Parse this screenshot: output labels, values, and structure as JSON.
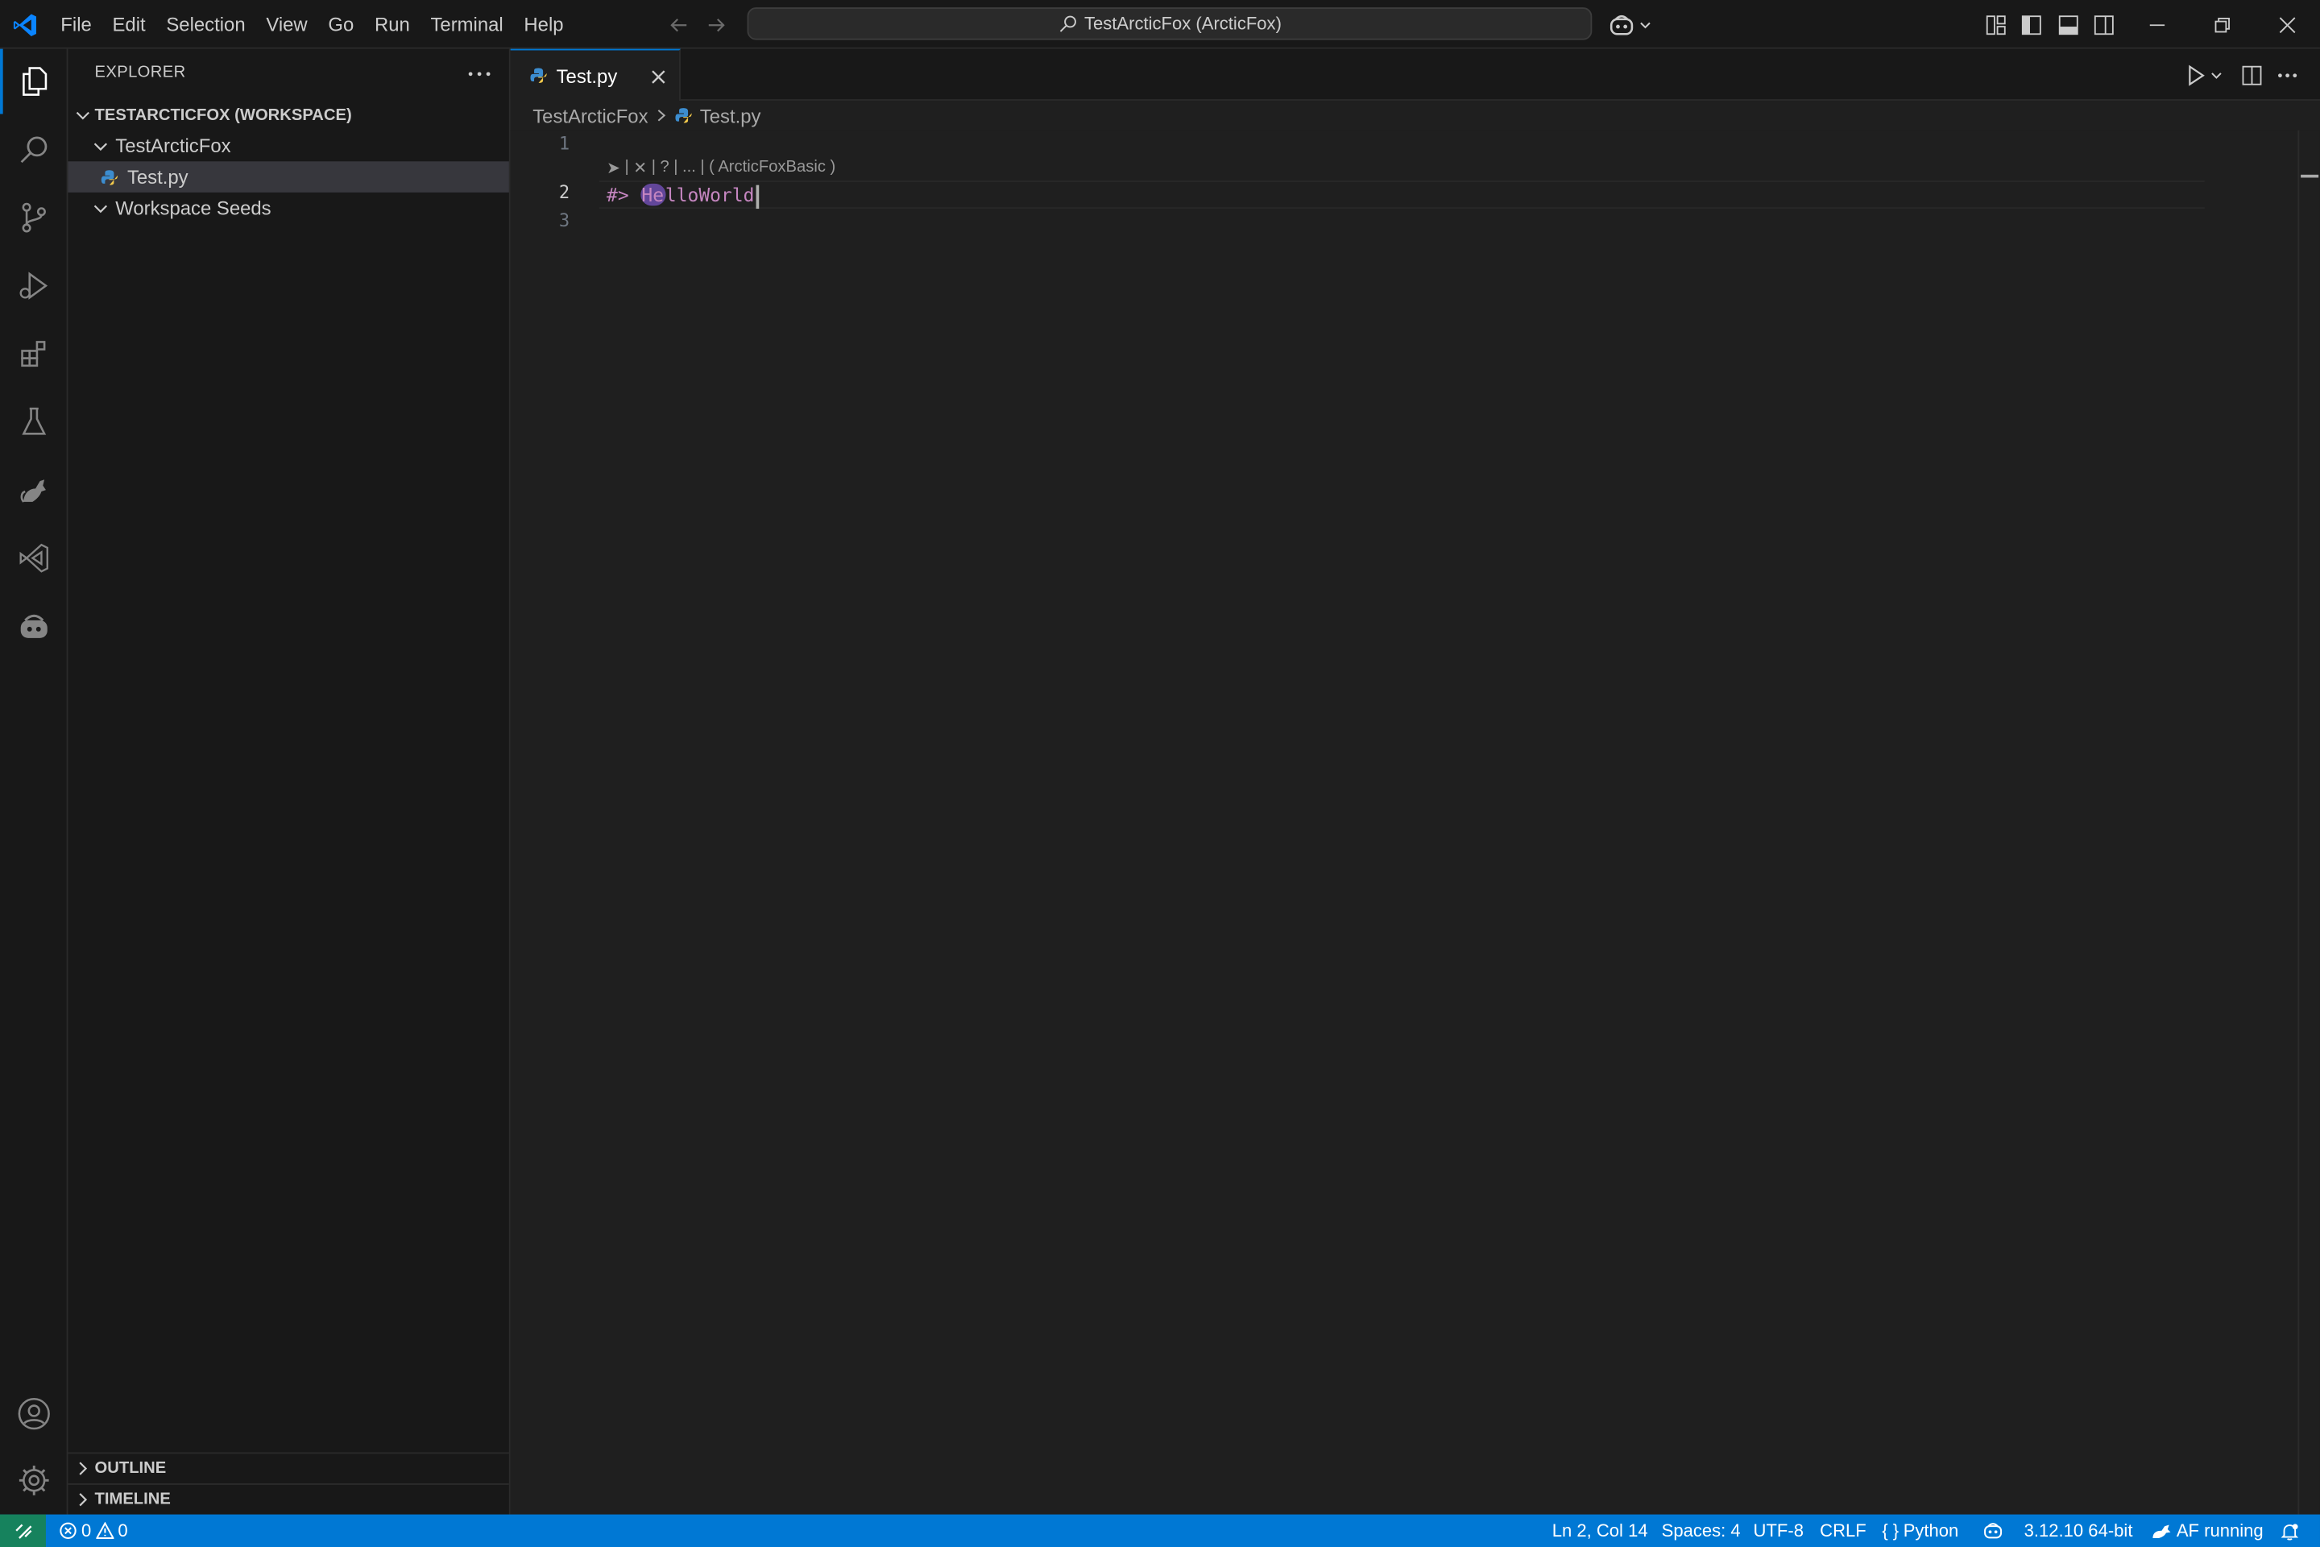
{
  "window": {
    "title": "TestArcticFox (ArcticFox)",
    "menu": [
      "File",
      "Edit",
      "Selection",
      "View",
      "Go",
      "Run",
      "Terminal",
      "Help"
    ]
  },
  "sidebar": {
    "title": "EXPLORER",
    "workspace": "TESTARCTICFOX (WORKSPACE)",
    "folders": [
      {
        "name": "TestArcticFox",
        "files": [
          "Test.py"
        ]
      },
      {
        "name": "Workspace Seeds",
        "files": []
      }
    ],
    "outline": "OUTLINE",
    "timeline": "TIMELINE"
  },
  "editor": {
    "tab": "Test.py",
    "breadcrumb": [
      "TestArcticFox",
      "Test.py"
    ],
    "line_numbers": [
      "1",
      "2",
      "3"
    ],
    "codelens": {
      "run": "➤",
      "sep1": "|",
      "close": "✕",
      "sep2": "|",
      "help": "?",
      "sep3": "|",
      "more": "...",
      "sep4": "|",
      "profile": "( ArcticFoxBasic )"
    },
    "line2": {
      "prefix": "#>",
      "highlight": "He",
      "rest": "lloWorld"
    }
  },
  "statusbar": {
    "errors": "0",
    "warnings": "0",
    "position": "Ln 2, Col 14",
    "spaces": "Spaces: 4",
    "encoding": "UTF-8",
    "eol": "CRLF",
    "language": "Python",
    "interpreter": "3.12.10 64-bit",
    "af_status": "AF running"
  },
  "colors": {
    "accent": "#0078d4",
    "remote": "#16825d",
    "background": "#1f1f1f",
    "sidebar": "#181818",
    "code_keyword": "#c586c0",
    "highlight": "#9966ff"
  }
}
